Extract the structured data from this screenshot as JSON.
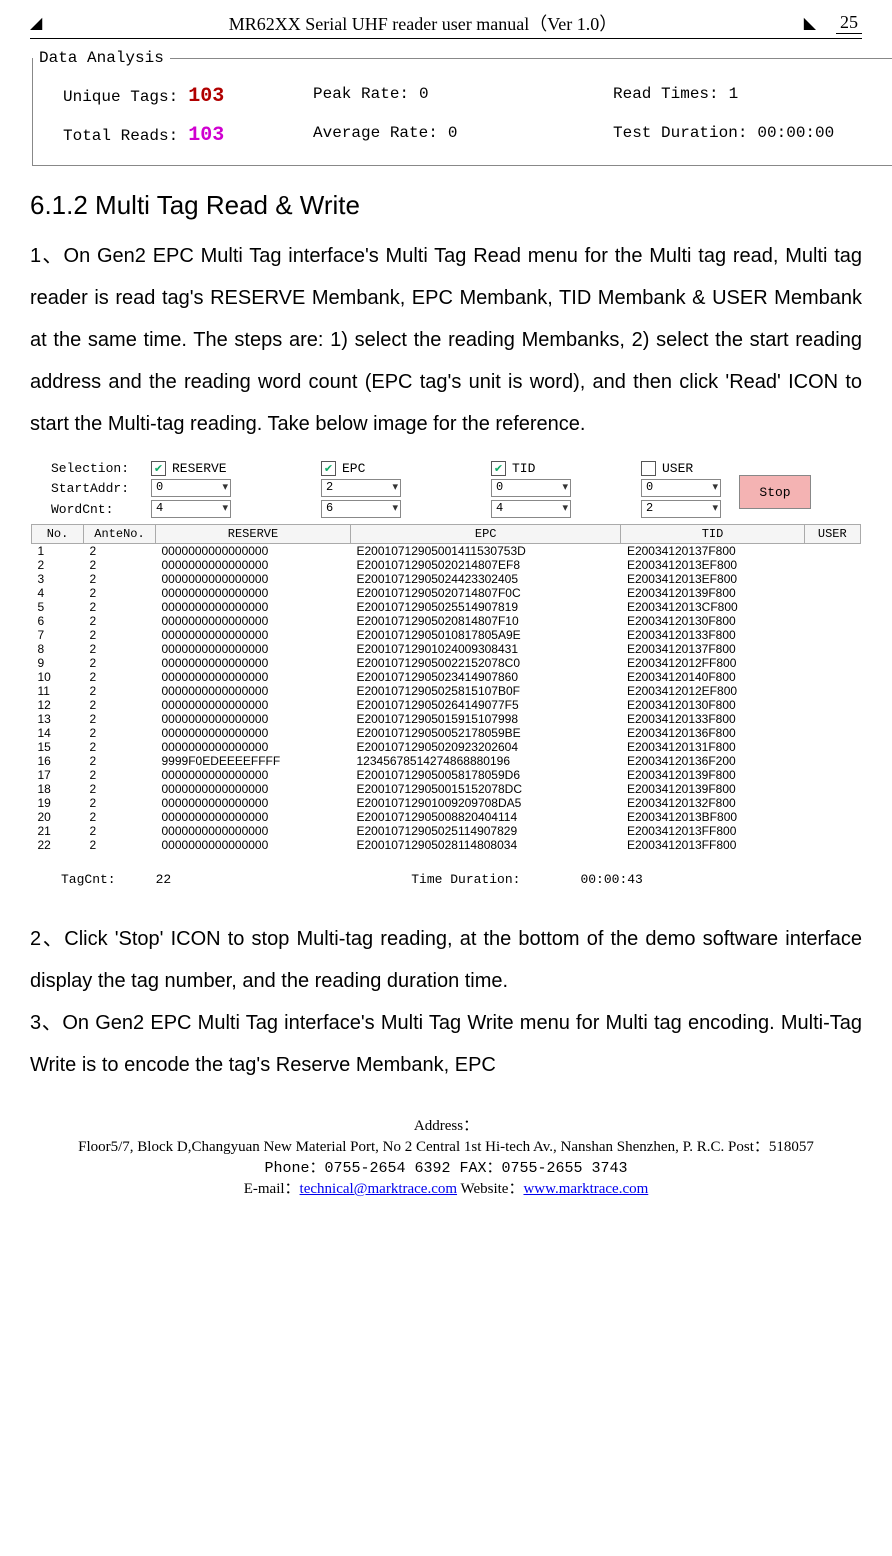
{
  "header": {
    "title": "MR62XX Serial UHF reader user manual（Ver 1.0）",
    "page": "25"
  },
  "data_analysis": {
    "legend": "Data Analysis",
    "unique_tags_label": "Unique Tags:",
    "unique_tags_value": "103",
    "peak_rate_label": "Peak Rate:",
    "peak_rate_value": "0",
    "read_times_label": "Read Times:",
    "read_times_value": "1",
    "total_reads_label": "Total Reads:",
    "total_reads_value": "103",
    "avg_rate_label": "Average Rate:",
    "avg_rate_value": "0",
    "test_dur_label": "Test Duration:",
    "test_dur_value": "00:00:00"
  },
  "section_heading": "6.1.2 Multi Tag Read & Write",
  "para1": "1、On Gen2 EPC Multi Tag interface's Multi Tag Read menu for the Multi tag read, Multi tag reader is read tag's RESERVE Membank, EPC Membank, TID Membank & USER Membank at the same time. The steps are: 1) select the reading Membanks, 2) select the start reading address and the reading word count (EPC tag's unit is word), and then click 'Read' ICON to start the Multi-tag reading. Take below image for the reference.",
  "config": {
    "selection_label": "Selection:",
    "startaddr_label": "StartAddr:",
    "wordcnt_label": "WordCnt:",
    "cols": [
      {
        "name": "RESERVE",
        "checked": true,
        "start": "0",
        "cnt": "4"
      },
      {
        "name": "EPC",
        "checked": true,
        "start": "2",
        "cnt": "6"
      },
      {
        "name": "TID",
        "checked": true,
        "start": "0",
        "cnt": "4"
      },
      {
        "name": "USER",
        "checked": false,
        "start": "0",
        "cnt": "2"
      }
    ],
    "stop_label": "Stop"
  },
  "table": {
    "headers": [
      "No.",
      "AnteNo.",
      "RESERVE",
      "EPC",
      "TID",
      "USER"
    ],
    "rows": [
      [
        "1",
        "2",
        "0000000000000000",
        "E20010712905001411530753D",
        "E20034120137F800",
        ""
      ],
      [
        "2",
        "2",
        "0000000000000000",
        "E20010712905020214807EF8",
        "E2003412013EF800",
        ""
      ],
      [
        "3",
        "2",
        "0000000000000000",
        "E20010712905024423302405",
        "E2003412013EF800",
        ""
      ],
      [
        "4",
        "2",
        "0000000000000000",
        "E20010712905020714807F0C",
        "E20034120139F800",
        ""
      ],
      [
        "5",
        "2",
        "0000000000000000",
        "E20010712905025514907819",
        "E2003412013CF800",
        ""
      ],
      [
        "6",
        "2",
        "0000000000000000",
        "E20010712905020814807F10",
        "E20034120130F800",
        ""
      ],
      [
        "7",
        "2",
        "0000000000000000",
        "E20010712905010817805A9E",
        "E20034120133F800",
        ""
      ],
      [
        "8",
        "2",
        "0000000000000000",
        "E20010712901024009308431",
        "E20034120137F800",
        ""
      ],
      [
        "9",
        "2",
        "0000000000000000",
        "E200107129050022152078C0",
        "E2003412012FF800",
        ""
      ],
      [
        "10",
        "2",
        "0000000000000000",
        "E20010712905023414907860",
        "E20034120140F800",
        ""
      ],
      [
        "11",
        "2",
        "0000000000000000",
        "E20010712905025815107B0F",
        "E2003412012EF800",
        ""
      ],
      [
        "12",
        "2",
        "0000000000000000",
        "E200107129050264149077F5",
        "E20034120130F800",
        ""
      ],
      [
        "13",
        "2",
        "0000000000000000",
        "E20010712905015915107998",
        "E20034120133F800",
        ""
      ],
      [
        "14",
        "2",
        "0000000000000000",
        "E200107129050052178059BE",
        "E20034120136F800",
        ""
      ],
      [
        "15",
        "2",
        "0000000000000000",
        "E20010712905020923202604",
        "E20034120131F800",
        ""
      ],
      [
        "16",
        "2",
        "9999F0EDEEEEFFFF",
        "12345678514274868880196",
        "E20034120136F200",
        ""
      ],
      [
        "17",
        "2",
        "0000000000000000",
        "E200107129050058178059D6",
        "E20034120139F800",
        ""
      ],
      [
        "18",
        "2",
        "0000000000000000",
        "E200107129050015152078DC",
        "E20034120139F800",
        ""
      ],
      [
        "19",
        "2",
        "0000000000000000",
        "E20010712901009209708DA5",
        "E20034120132F800",
        ""
      ],
      [
        "20",
        "2",
        "0000000000000000",
        "E20010712905008820404114",
        "E2003412013BF800",
        ""
      ],
      [
        "21",
        "2",
        "0000000000000000",
        "E20010712905025114907829",
        "E2003412013FF800",
        ""
      ],
      [
        "22",
        "2",
        "0000000000000000",
        "E20010712905028114808034",
        "E2003412013FF800",
        ""
      ]
    ]
  },
  "summary": {
    "tagcnt_label": "TagCnt:",
    "tagcnt_value": "22",
    "time_label": "Time Duration:",
    "time_value": "00:00:43"
  },
  "para2": "2、Click 'Stop' ICON to stop Multi-tag reading, at the bottom of the demo software interface display the tag number, and the reading duration time.",
  "para3": "3、On Gen2 EPC Multi Tag interface's Multi Tag Write menu for Multi tag encoding. Multi-Tag Write is to encode the tag's Reserve Membank, EPC",
  "footer": {
    "addr_label": "Address：",
    "addr": "Floor5/7, Block D,Changyuan New  Material Port, No 2 Central 1st Hi-tech Av., Nanshan Shenzhen, P. R.C.   Post：518057",
    "phone": "Phone：0755-2654 6392   FAX：0755-2655 3743",
    "email_label": "E-mail：",
    "email": "technical@marktrace.com",
    "web_label": "     Website：",
    "web": "www.marktrace.com"
  }
}
